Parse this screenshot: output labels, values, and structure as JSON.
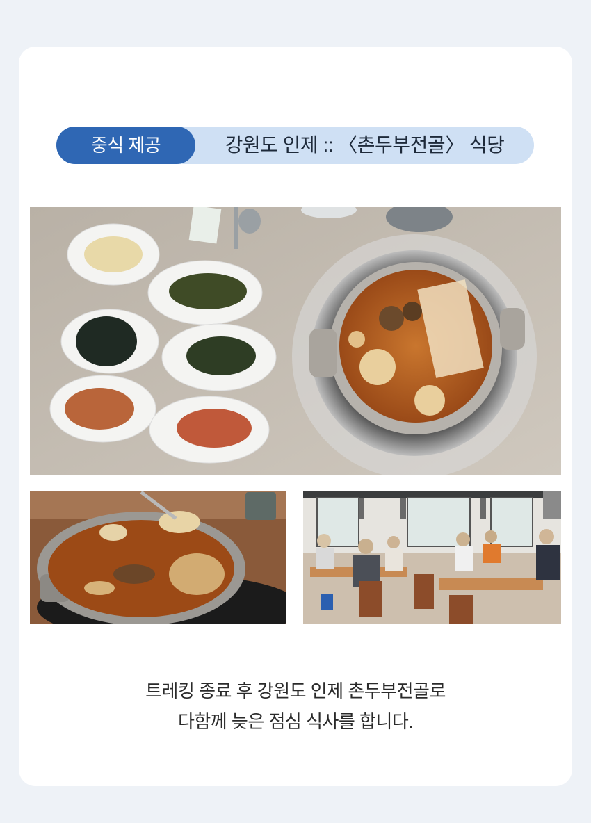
{
  "header": {
    "badge_label": "중식 제공",
    "title": "강원도 인제 :: 〈촌두부전골〉 식당"
  },
  "photos": {
    "main_photo": "hotpot-with-side-dishes",
    "left_photo": "hotpot-close-up",
    "right_photo": "restaurant-dining-hall"
  },
  "caption": {
    "line1": "트레킹 종료 후 강원도 인제 촌두부전골로",
    "line2": "다함께 늦은 점심 식사를 합니다."
  },
  "colors": {
    "badge_bg": "#2f67b4",
    "pill_bg": "#cfe0f4",
    "page_bg": "#eef2f7"
  }
}
